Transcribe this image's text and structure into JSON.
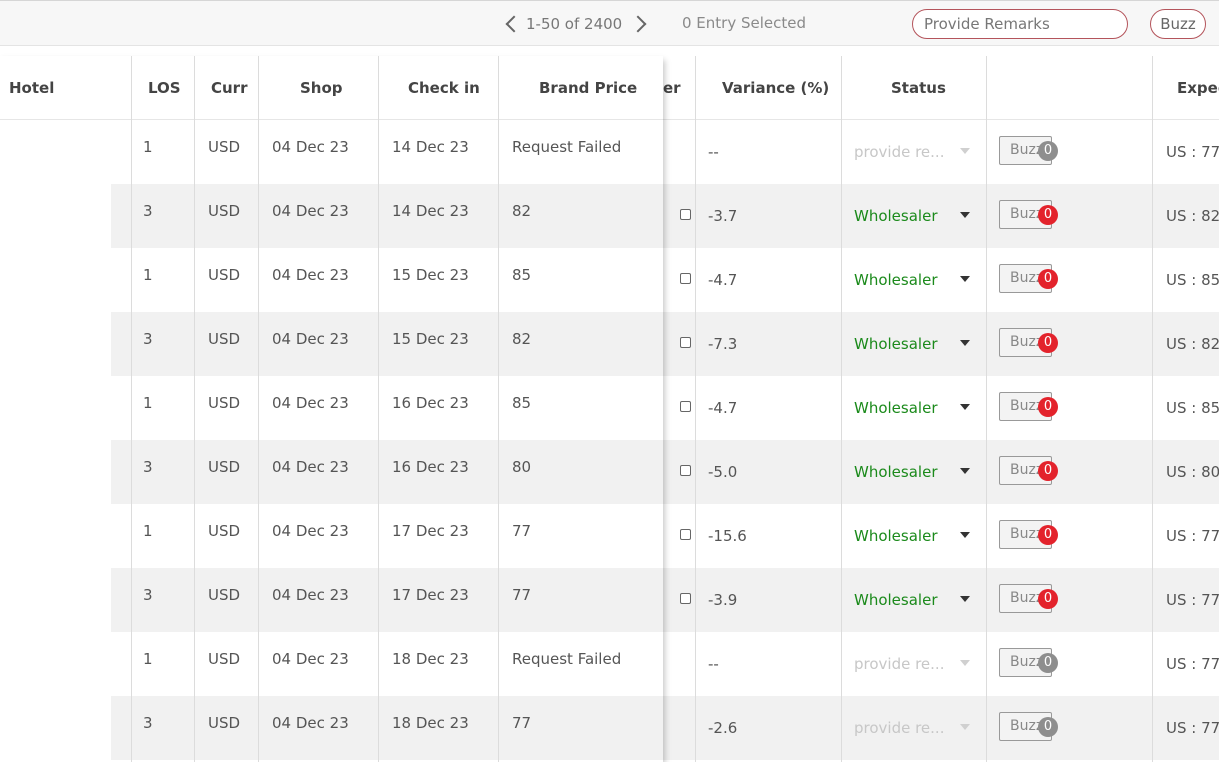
{
  "toolbar": {
    "pagination": "1-50 of 2400",
    "selected": "0 Entry Selected",
    "remarks_placeholder": "Provide Remarks",
    "buzz_label": "Buzz"
  },
  "columns": {
    "hotel": "Hotel",
    "los": "LOS",
    "curr": "Curr",
    "shop": "Shop",
    "checkin": "Check in",
    "brand_price": "Brand Price",
    "partial": "er",
    "variance": "Variance (%)",
    "status": "Status",
    "expedia": "Exped"
  },
  "rows": [
    {
      "los": "1",
      "curr": "USD",
      "shop": "04 Dec 23",
      "checkin": "14 Dec 23",
      "brand_price": "Request Failed",
      "checkbox": false,
      "variance": "--",
      "status": "provide re...",
      "status_active": false,
      "buzz": "Buzz",
      "buzz_count": "0",
      "expedia": "US : 77"
    },
    {
      "los": "3",
      "curr": "USD",
      "shop": "04 Dec 23",
      "checkin": "14 Dec 23",
      "brand_price": "82",
      "checkbox": true,
      "variance": "-3.7",
      "status": "Wholesaler",
      "status_active": true,
      "buzz": "Buzz",
      "buzz_count": "0",
      "expedia": "US : 82"
    },
    {
      "los": "1",
      "curr": "USD",
      "shop": "04 Dec 23",
      "checkin": "15 Dec 23",
      "brand_price": "85",
      "checkbox": true,
      "variance": "-4.7",
      "status": "Wholesaler",
      "status_active": true,
      "buzz": "Buzz",
      "buzz_count": "0",
      "expedia": "US : 85"
    },
    {
      "los": "3",
      "curr": "USD",
      "shop": "04 Dec 23",
      "checkin": "15 Dec 23",
      "brand_price": "82",
      "checkbox": true,
      "variance": "-7.3",
      "status": "Wholesaler",
      "status_active": true,
      "buzz": "Buzz",
      "buzz_count": "0",
      "expedia": "US : 82"
    },
    {
      "los": "1",
      "curr": "USD",
      "shop": "04 Dec 23",
      "checkin": "16 Dec 23",
      "brand_price": "85",
      "checkbox": true,
      "variance": "-4.7",
      "status": "Wholesaler",
      "status_active": true,
      "buzz": "Buzz",
      "buzz_count": "0",
      "expedia": "US : 85"
    },
    {
      "los": "3",
      "curr": "USD",
      "shop": "04 Dec 23",
      "checkin": "16 Dec 23",
      "brand_price": "80",
      "checkbox": true,
      "variance": "-5.0",
      "status": "Wholesaler",
      "status_active": true,
      "buzz": "Buzz",
      "buzz_count": "0",
      "expedia": "US : 80"
    },
    {
      "los": "1",
      "curr": "USD",
      "shop": "04 Dec 23",
      "checkin": "17 Dec 23",
      "brand_price": "77",
      "checkbox": true,
      "variance": "-15.6",
      "status": "Wholesaler",
      "status_active": true,
      "buzz": "Buzz",
      "buzz_count": "0",
      "expedia": "US : 77"
    },
    {
      "los": "3",
      "curr": "USD",
      "shop": "04 Dec 23",
      "checkin": "17 Dec 23",
      "brand_price": "77",
      "checkbox": true,
      "variance": "-3.9",
      "status": "Wholesaler",
      "status_active": true,
      "buzz": "Buzz",
      "buzz_count": "0",
      "expedia": "US : 77"
    },
    {
      "los": "1",
      "curr": "USD",
      "shop": "04 Dec 23",
      "checkin": "18 Dec 23",
      "brand_price": "Request Failed",
      "checkbox": false,
      "variance": "--",
      "status": "provide re...",
      "status_active": false,
      "buzz": "Buzz",
      "buzz_count": "0",
      "expedia": "US : 77"
    },
    {
      "los": "3",
      "curr": "USD",
      "shop": "04 Dec 23",
      "checkin": "18 Dec 23",
      "brand_price": "77",
      "checkbox": false,
      "variance": "-2.6",
      "status": "provide re...",
      "status_active": false,
      "buzz": "Buzz",
      "buzz_count": "0",
      "expedia": "US : 77"
    }
  ],
  "colors": {
    "accent": "#b4545b",
    "status_green": "#1b8a1b",
    "badge_red": "#e3232c",
    "badge_grey": "#8e8e8e"
  },
  "icons": {
    "prev": "chevron-left-icon",
    "next": "chevron-right-icon",
    "dropdown": "caret-down-icon"
  }
}
